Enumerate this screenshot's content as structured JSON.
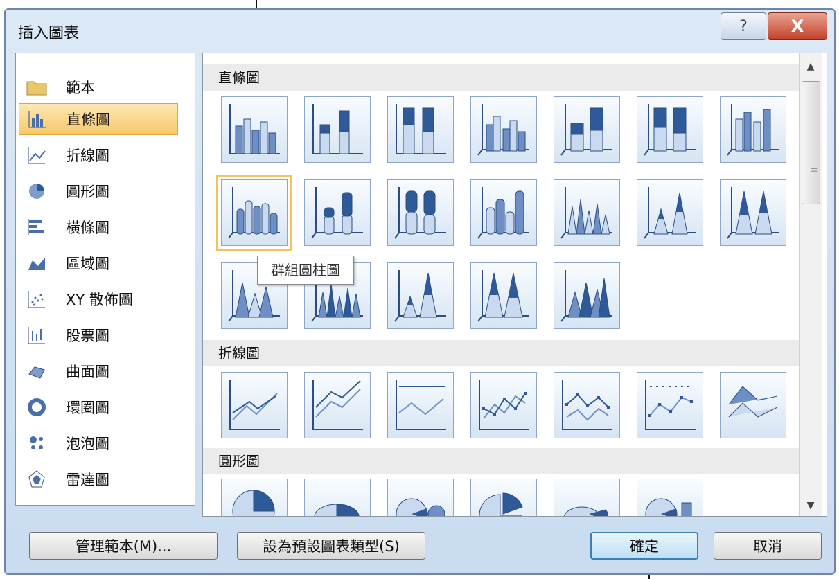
{
  "dialog": {
    "title": "插入圖表",
    "help_label": "?",
    "close_label": "X"
  },
  "categories": [
    {
      "label": "範本",
      "icon": "folder-icon"
    },
    {
      "label": "直條圖",
      "icon": "column-chart-icon",
      "selected": true
    },
    {
      "label": "折線圖",
      "icon": "line-chart-icon"
    },
    {
      "label": "圓形圖",
      "icon": "pie-chart-icon"
    },
    {
      "label": "橫條圖",
      "icon": "bar-chart-icon"
    },
    {
      "label": "區域圖",
      "icon": "area-chart-icon"
    },
    {
      "label": "XY 散佈圖",
      "icon": "scatter-chart-icon"
    },
    {
      "label": "股票圖",
      "icon": "stock-chart-icon"
    },
    {
      "label": "曲面圖",
      "icon": "surface-chart-icon"
    },
    {
      "label": "環圈圖",
      "icon": "doughnut-chart-icon"
    },
    {
      "label": "泡泡圖",
      "icon": "bubble-chart-icon"
    },
    {
      "label": "雷達圖",
      "icon": "radar-chart-icon"
    }
  ],
  "sections": {
    "column": "直條圖",
    "line": "折線圖",
    "pie": "圓形圖"
  },
  "tooltip": "群組圓柱圖",
  "buttons": {
    "manage_templates": "管理範本(M)...",
    "set_default": "設為預設圖表類型(S)",
    "ok": "確定",
    "cancel": "取消"
  },
  "colors": {
    "selection": "#f7c86a",
    "chart_blue": "#5b7fb6"
  }
}
